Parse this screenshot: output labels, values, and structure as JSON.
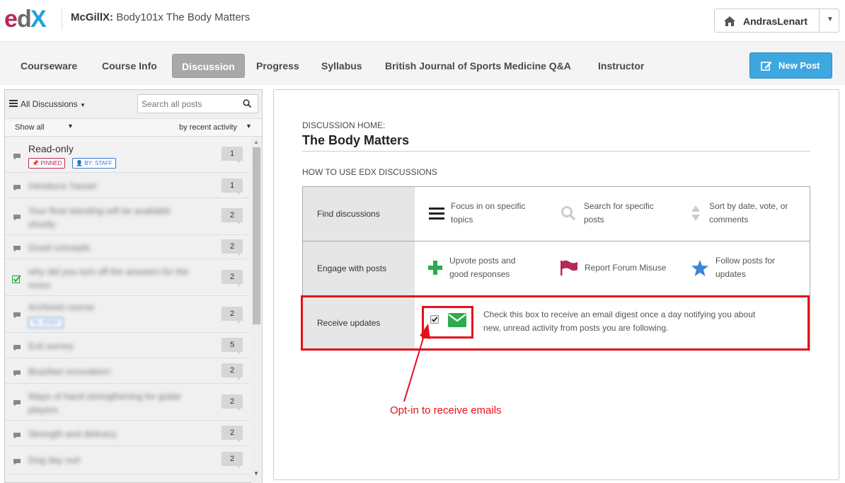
{
  "header": {
    "logo_text": "edX",
    "course_org": "McGillX:",
    "course_name": "Body101x The Body Matters",
    "username": "AndrasLenart"
  },
  "nav": {
    "tabs": [
      {
        "label": "Courseware",
        "active": false
      },
      {
        "label": "Course Info",
        "active": false
      },
      {
        "label": "Discussion",
        "active": true
      },
      {
        "label": "Progress",
        "active": false
      },
      {
        "label": "Syllabus",
        "active": false
      },
      {
        "label": "British Journal of Sports Medicine Q&A",
        "active": false
      },
      {
        "label": "Instructor",
        "active": false
      }
    ],
    "new_post_label": "New Post"
  },
  "sidebar": {
    "filter_label": "All Discussions",
    "search_placeholder": "Search all posts",
    "show_label": "Show all",
    "sort_label": "by recent activity",
    "threads": [
      {
        "title": "Read-only",
        "count": "1",
        "pinned": "PINNED",
        "staff": "BY: STAFF",
        "blurred": false,
        "following": false
      },
      {
        "title": "Introduce Yasser",
        "count": "1",
        "blurred": true,
        "following": false
      },
      {
        "title": "Your final standing will be available shortly",
        "count": "2",
        "blurred": true,
        "following": false
      },
      {
        "title": "Good concepts",
        "count": "2",
        "blurred": true,
        "following": false
      },
      {
        "title": "why did you turn off the answers for the mooc",
        "count": "2",
        "blurred": true,
        "following": true
      },
      {
        "title": "Archived course",
        "count": "2",
        "badge": "TA: STAFF",
        "blurred": true,
        "following": false
      },
      {
        "title": "Exit survey",
        "count": "5",
        "blurred": true,
        "following": false
      },
      {
        "title": "Brazilian innovation!",
        "count": "2",
        "blurred": true,
        "following": false
      },
      {
        "title": "Ways of hand strengthening for guitar players",
        "count": "2",
        "blurred": true,
        "following": false
      },
      {
        "title": "Strength and delicacy",
        "count": "2",
        "blurred": true,
        "following": false
      },
      {
        "title": "Dog day out!",
        "count": "2",
        "blurred": true,
        "following": false
      }
    ]
  },
  "main": {
    "home_label": "DISCUSSION HOME:",
    "home_title": "The Body Matters",
    "howto_label": "HOW TO USE EDX DISCUSSIONS",
    "rows": [
      {
        "heading": "Find discussions",
        "items": [
          {
            "icon": "list-icon",
            "text_line1": "Focus in on specific",
            "text_line2": "topics"
          },
          {
            "icon": "search-icon",
            "text_line1": "Search for specific",
            "text_line2": "posts"
          },
          {
            "icon": "sort-icon",
            "text_line1": "Sort by date, vote, or",
            "text_line2": "comments"
          }
        ]
      },
      {
        "heading": "Engage with posts",
        "items": [
          {
            "icon": "plus-icon",
            "text_line1": "Upvote posts and",
            "text_line2": "good responses"
          },
          {
            "icon": "flag-icon",
            "text_line1": "Report Forum Misuse",
            "text_line2": ""
          },
          {
            "icon": "star-icon",
            "text_line1": "Follow posts for",
            "text_line2": "updates"
          }
        ]
      },
      {
        "heading": "Receive updates",
        "checkbox_checked": true,
        "text_line1": "Check this box to receive an email digest once a day notifying you about",
        "text_line2": "new, unread activity from posts you are following."
      }
    ]
  },
  "annotation": {
    "text": "Opt-in to receive emails",
    "color": "#e3101a"
  },
  "colors": {
    "accent": "#3fa7e0",
    "pinned": "#b5285b",
    "staff": "#3a7bc8",
    "success": "#2bac4e",
    "flag": "#b5285b",
    "star": "#3a86d4"
  }
}
